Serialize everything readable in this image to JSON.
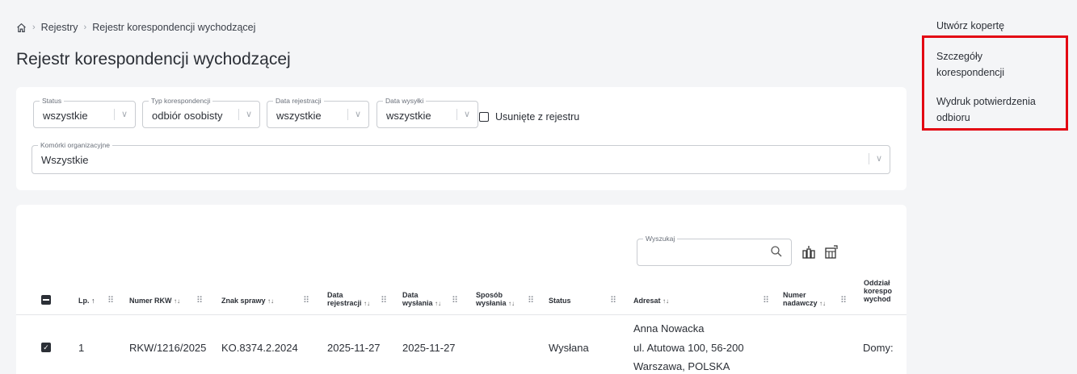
{
  "breadcrumb": {
    "home_icon": "home-icon",
    "items": [
      "Rejestry",
      "Rejestr korespondencji wychodzącej"
    ]
  },
  "page": {
    "title": "Rejestr korespondencji wychodzącej"
  },
  "filters": {
    "status": {
      "label": "Status",
      "value": "wszystkie"
    },
    "type": {
      "label": "Typ korespondencji",
      "value": "odbiór osobisty"
    },
    "reg_date": {
      "label": "Data rejestracji",
      "value": "wszystkie"
    },
    "send_date": {
      "label": "Data wysyłki",
      "value": "wszystkie"
    },
    "deleted": {
      "label": "Usunięte z rejestru",
      "checked": false
    },
    "org_units": {
      "label": "Komórki organizacyjne",
      "value": "Wszystkie"
    }
  },
  "table": {
    "search": {
      "label": "Wyszukaj",
      "value": ""
    },
    "columns": {
      "lp": "Lp. ↑",
      "rkw": "Numer RKW",
      "case": "Znak sprawy",
      "reg_date_1": "Data",
      "reg_date_2": "rejestracji",
      "send_date_1": "Data",
      "send_date_2": "wysłania",
      "method_1": "Sposób",
      "method_2": "wysłania",
      "status": "Status",
      "addressee": "Adresat",
      "sender_no_1": "Numer",
      "sender_no_2": "nadawczy",
      "branch_1": "Oddział",
      "branch_2": "korespo",
      "branch_3": "wychod"
    },
    "rows": [
      {
        "lp": "1",
        "rkw": "RKW/1216/2025",
        "case": "KO.8374.2.2024",
        "reg_date": "2025-11-27",
        "send_date": "2025-11-27",
        "method": "",
        "status": "Wysłana",
        "addressee_line1": "Anna Nowacka",
        "addressee_line2": "ul. Atutowa 100, 56-200",
        "addressee_line3": "Warszawa, POLSKA",
        "sender_no": "",
        "branch": "Domy:",
        "selected": true
      }
    ]
  },
  "sidebar": {
    "items": [
      {
        "label": "Utwórz kopertę"
      },
      {
        "label_1": "Szczegóły",
        "label_2": "korespondencji"
      },
      {
        "label_1": "Wydruk potwierdzenia",
        "label_2": "odbioru"
      }
    ]
  },
  "colors": {
    "highlight": "#e30613",
    "text": "#2b2f36",
    "background": "#f4f5f7"
  }
}
